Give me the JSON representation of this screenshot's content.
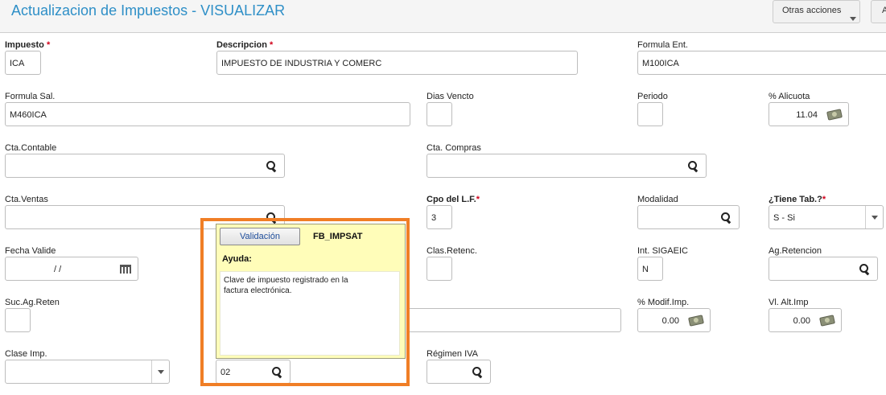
{
  "header": {
    "title": "Actualizacion de Impuestos - VISUALIZAR",
    "actions_label": "Otras acciones",
    "edge_button_label": "A"
  },
  "fields": {
    "impuesto": {
      "label": "Impuesto",
      "required": "*",
      "value": "ICA"
    },
    "descripcion": {
      "label": "Descripcion",
      "required": "*",
      "value": "IMPUESTO DE INDUSTRIA Y COMERC"
    },
    "formula_ent": {
      "label": "Formula Ent.",
      "value": "M100ICA"
    },
    "formula_sal": {
      "label": "Formula Sal.",
      "value": "M460ICA"
    },
    "dias_vencto": {
      "label": "Dias Vencto",
      "value": ""
    },
    "periodo": {
      "label": "Periodo",
      "value": ""
    },
    "alicuota": {
      "label": "% Alicuota",
      "value": "11.04"
    },
    "cta_contable": {
      "label": "Cta.Contable",
      "value": ""
    },
    "cta_compras": {
      "label": "Cta. Compras",
      "value": ""
    },
    "cta_ventas": {
      "label": "Cta.Ventas",
      "value": ""
    },
    "cpo_lf": {
      "label": "Cpo del L.F.",
      "required": "*",
      "value": "3"
    },
    "modalidad": {
      "label": "Modalidad",
      "value": ""
    },
    "tiene_tab": {
      "label": "¿Tiene Tab.?",
      "required": "*",
      "value": "S -  Si"
    },
    "fecha_valide": {
      "label": "Fecha Valide",
      "value": "/ /"
    },
    "clas_retenc": {
      "label": "Clas.Retenc.",
      "value": ""
    },
    "int_sigaeic": {
      "label": "Int. SIGAEIC",
      "value": "N"
    },
    "ag_retencion": {
      "label": "Ag.Retencion",
      "value": ""
    },
    "suc_ag_reten": {
      "label": "Suc.Ag.Reten",
      "value": ""
    },
    "modif_imp": {
      "label": "% Modif.Imp.",
      "value": "0.00"
    },
    "vl_alt_imp": {
      "label": "Vl. Alt.Imp",
      "value": "0.00"
    },
    "clase_imp": {
      "label": "Clase Imp.",
      "value": ""
    },
    "fb_impsat": {
      "value": "02"
    },
    "regimen_iva": {
      "label": "Régimen IVA",
      "value": ""
    }
  },
  "tooltip": {
    "button_label": "Validación",
    "field_code": "FB_IMPSAT",
    "help_heading": "Ayuda:",
    "help_text_line1": "Clave de impuesto registrado en la",
    "help_text_line2": "factura electrónica.",
    "highlight_color": "#f07e26"
  },
  "theme": {
    "title_color": "#2e8fc7",
    "required_color": "#d0021b",
    "tooltip_bg": "#fffdb9"
  },
  "icons": [
    "search-icon",
    "money-icon",
    "calendar-icon",
    "chevron-down-icon"
  ]
}
